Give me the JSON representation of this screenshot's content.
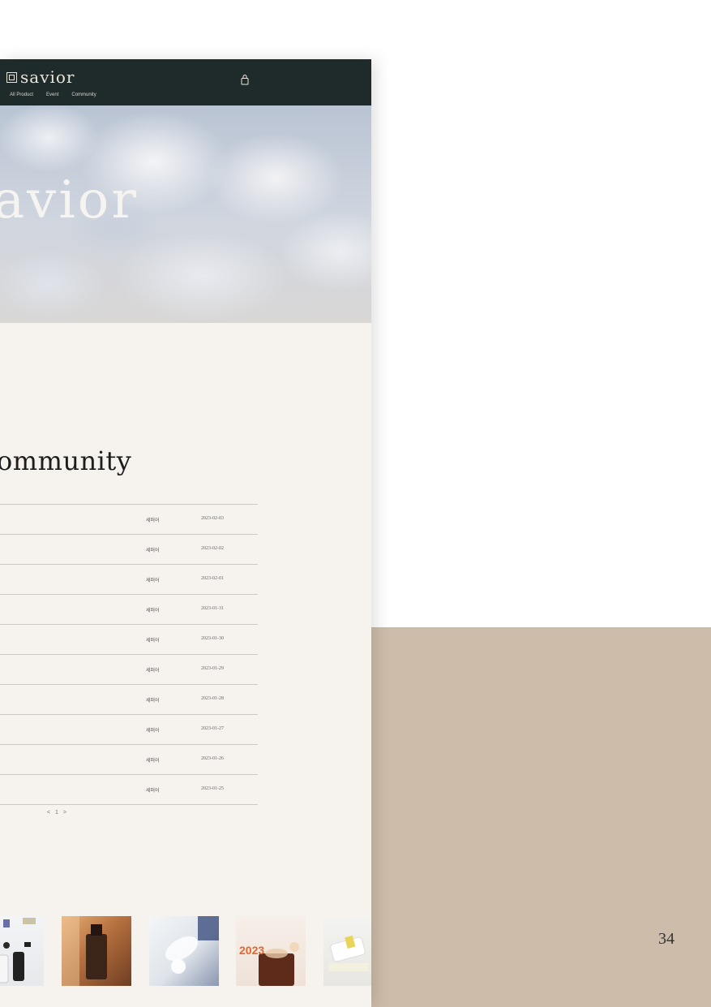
{
  "header": {
    "logo_text": "savior",
    "nav": [
      "All Product",
      "Event",
      "Community"
    ],
    "cart_icon": "shopping-bag-icon"
  },
  "hero": {
    "word": "avior"
  },
  "board": {
    "title": "ommunity",
    "rows": [
      {
        "author": "세퍼어",
        "date": "2023-02-03"
      },
      {
        "author": "세퍼어",
        "date": "2023-02-02"
      },
      {
        "author": "세퍼어",
        "date": "2023-02-01"
      },
      {
        "author": "세퍼어",
        "date": "2023-01-31"
      },
      {
        "author": "세퍼어",
        "date": "2023-01-30"
      },
      {
        "author": "세퍼어",
        "date": "2023-01-29"
      },
      {
        "author": "세퍼어",
        "date": "2023-01-28"
      },
      {
        "author": "세퍼어",
        "date": "2023-01-27"
      },
      {
        "author": "세퍼어",
        "date": "2023-01-26"
      },
      {
        "author": "세퍼어",
        "date": "2023-01-25"
      }
    ],
    "pager": "< 1 >"
  },
  "thumbnails": {
    "thumb4_label": "2023"
  },
  "slide": {
    "page_number": "34"
  },
  "colors": {
    "header_bg": "#1f2b2b",
    "site_bg": "#f6f2ee",
    "side_panel": "#cdbca9"
  }
}
